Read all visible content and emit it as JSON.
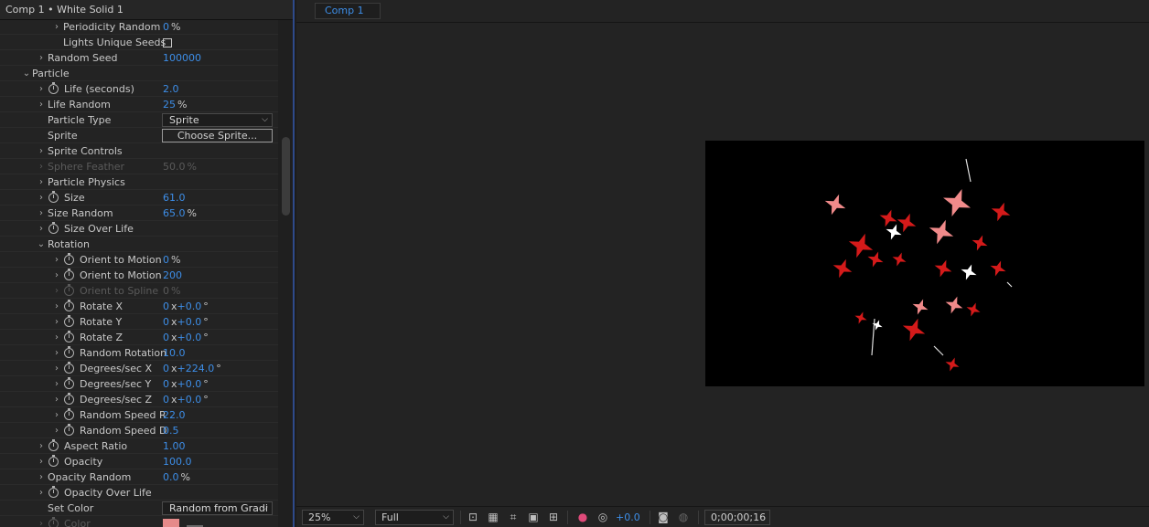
{
  "effects_panel": {
    "title": "Comp 1 • White Solid 1",
    "rows": [
      {
        "label": "Periodicity Random",
        "value": "0",
        "unit": "%",
        "level": 3,
        "arrow": "closed",
        "stopwatch": false
      },
      {
        "label": "Lights Unique Seeds",
        "level": 3,
        "arrow": "none",
        "stopwatch": false,
        "control": "checkbox"
      },
      {
        "label": "Random Seed",
        "value": "100000",
        "level": 2,
        "arrow": "closed",
        "stopwatch": false
      },
      {
        "label": "Particle",
        "level": 1,
        "arrow": "open",
        "stopwatch": false
      },
      {
        "label": "Life (seconds)",
        "value": "2.0",
        "level": 2,
        "arrow": "closed",
        "stopwatch": true
      },
      {
        "label": "Life Random",
        "value": "25",
        "unit": "%",
        "level": 2,
        "arrow": "closed",
        "stopwatch": false
      },
      {
        "label": "Particle Type",
        "level": 2,
        "arrow": "none",
        "stopwatch": false,
        "control": "dropdown",
        "control_value": "Sprite"
      },
      {
        "label": "Sprite",
        "level": 2,
        "arrow": "none",
        "stopwatch": false,
        "control": "button",
        "control_value": "Choose Sprite..."
      },
      {
        "label": "Sprite Controls",
        "level": 2,
        "arrow": "closed",
        "stopwatch": false
      },
      {
        "label": "Sphere Feather",
        "value": "50.0",
        "unit": "%",
        "level": 2,
        "arrow": "closed",
        "stopwatch": false,
        "dim": true
      },
      {
        "label": "Particle Physics",
        "level": 2,
        "arrow": "closed",
        "stopwatch": false
      },
      {
        "label": "Size",
        "value": "61.0",
        "level": 2,
        "arrow": "closed",
        "stopwatch": true
      },
      {
        "label": "Size Random",
        "value": "65.0",
        "unit": "%",
        "level": 2,
        "arrow": "closed",
        "stopwatch": false
      },
      {
        "label": "Size Over Life",
        "level": 2,
        "arrow": "closed",
        "stopwatch": true
      },
      {
        "label": "Rotation",
        "level": 2,
        "arrow": "open",
        "stopwatch": false
      },
      {
        "label": "Orient to Motion",
        "value": "0",
        "unit": "%",
        "level": 3,
        "arrow": "closed",
        "stopwatch": true
      },
      {
        "label": "Orient to Motion",
        "value": "200",
        "level": 3,
        "arrow": "closed",
        "stopwatch": true
      },
      {
        "label": "Orient to Spline",
        "value": "0",
        "unit": "%",
        "level": 3,
        "arrow": "closed",
        "stopwatch": true,
        "dim": true
      },
      {
        "label": "Rotate X",
        "value": "0",
        "unit": "x",
        "value2": "+0.0",
        "unit2": "°",
        "level": 3,
        "arrow": "closed",
        "stopwatch": true
      },
      {
        "label": "Rotate Y",
        "value": "0",
        "unit": "x",
        "value2": "+0.0",
        "unit2": "°",
        "level": 3,
        "arrow": "closed",
        "stopwatch": true
      },
      {
        "label": "Rotate Z",
        "value": "0",
        "unit": "x",
        "value2": "+0.0",
        "unit2": "°",
        "level": 3,
        "arrow": "closed",
        "stopwatch": true
      },
      {
        "label": "Random Rotation",
        "value": "10.0",
        "level": 3,
        "arrow": "closed",
        "stopwatch": true
      },
      {
        "label": "Degrees/sec X",
        "value": "0",
        "unit": "x",
        "value2": "+224.0",
        "unit2": "°",
        "level": 3,
        "arrow": "closed",
        "stopwatch": true
      },
      {
        "label": "Degrees/sec Y",
        "value": "0",
        "unit": "x",
        "value2": "+0.0",
        "unit2": "°",
        "level": 3,
        "arrow": "closed",
        "stopwatch": true
      },
      {
        "label": "Degrees/sec Z",
        "value": "0",
        "unit": "x",
        "value2": "+0.0",
        "unit2": "°",
        "level": 3,
        "arrow": "closed",
        "stopwatch": true
      },
      {
        "label": "Random Speed R",
        "value": "22.0",
        "level": 3,
        "arrow": "closed",
        "stopwatch": true
      },
      {
        "label": "Random Speed D",
        "value": "0.5",
        "level": 3,
        "arrow": "closed",
        "stopwatch": true
      },
      {
        "label": "Aspect Ratio",
        "value": "1.00",
        "level": 2,
        "arrow": "closed",
        "stopwatch": true
      },
      {
        "label": "Opacity",
        "value": "100.0",
        "level": 2,
        "arrow": "closed",
        "stopwatch": true
      },
      {
        "label": "Opacity Random",
        "value": "0.0",
        "unit": "%",
        "level": 2,
        "arrow": "closed",
        "stopwatch": false
      },
      {
        "label": "Opacity Over Life",
        "level": 2,
        "arrow": "closed",
        "stopwatch": true
      },
      {
        "label": "Set Color",
        "level": 2,
        "arrow": "none",
        "stopwatch": false,
        "control": "dropdown",
        "control_value": "Random from Gradi"
      },
      {
        "label": "Color",
        "level": 2,
        "arrow": "closed",
        "stopwatch": true,
        "dim": true,
        "control": "swatch"
      }
    ]
  },
  "composition_panel": {
    "tab_label": "Comp 1",
    "toolbar": {
      "zoom": "25%",
      "resolution": "Full",
      "exposure": "+0.0",
      "timecode": "0;00;00;16"
    }
  },
  "colors": {
    "accent_blue": "#3d8ee8",
    "panel_bg": "#232323",
    "particle_red": "#d41a1a",
    "particle_pink": "#f08a8a",
    "swatch": "#e58a8a"
  }
}
